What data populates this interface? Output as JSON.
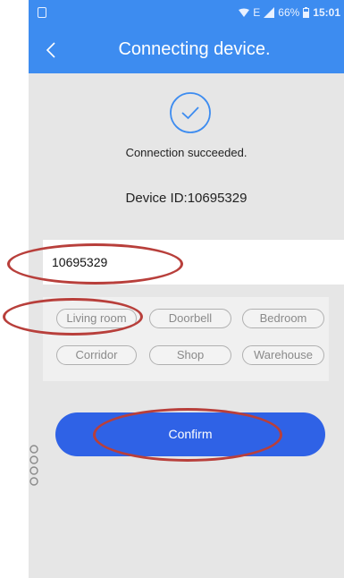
{
  "status_bar": {
    "battery": "66%",
    "time": "15:01",
    "network": "E"
  },
  "header": {
    "title": "Connecting device."
  },
  "connection": {
    "message": "Connection succeeded.",
    "device_id_label": "Device ID:10695329"
  },
  "device_name_input": {
    "value": "10695329"
  },
  "room_tags": [
    "Living room",
    "Doorbell",
    "Bedroom",
    "Corridor",
    "Shop",
    "Warehouse"
  ],
  "confirm_label": "Confirm",
  "colors": {
    "accent": "#3d8cf0",
    "button": "#2f62e6",
    "annotation": "#b83f3b"
  }
}
